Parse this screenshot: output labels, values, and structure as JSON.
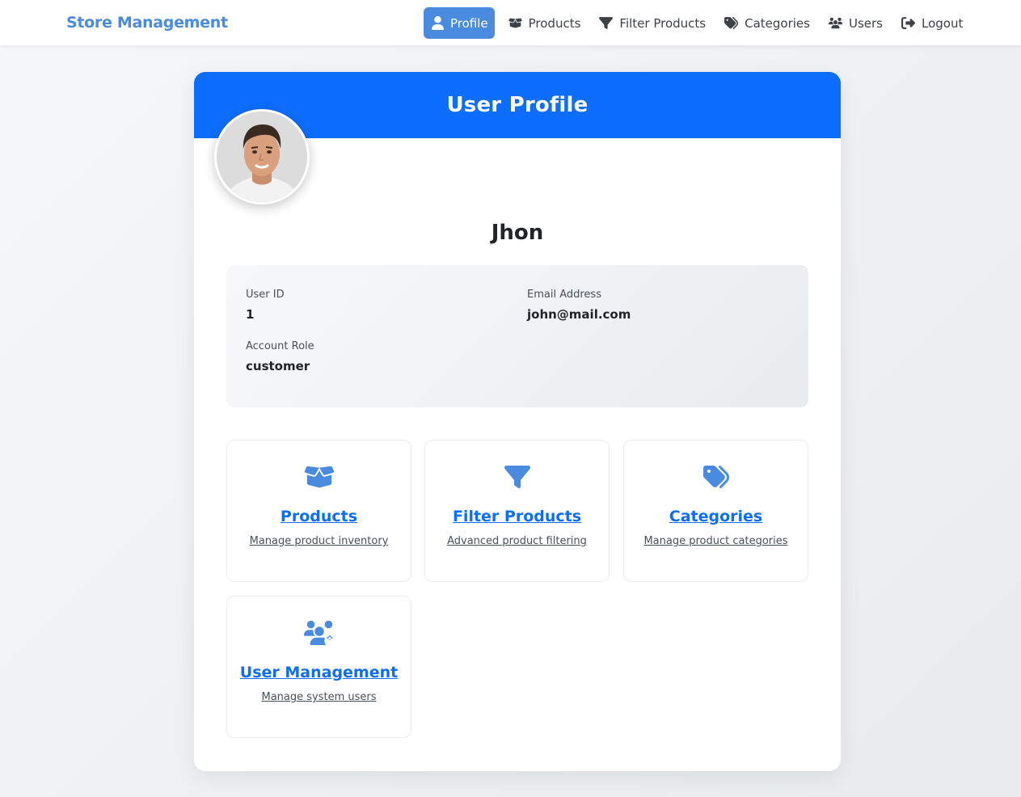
{
  "navbar": {
    "brand": "Store Management",
    "items": [
      {
        "label": "Profile",
        "icon": "user-icon",
        "active": true
      },
      {
        "label": "Products",
        "icon": "box-open-icon"
      },
      {
        "label": "Filter Products",
        "icon": "filter-icon"
      },
      {
        "label": "Categories",
        "icon": "tags-icon"
      },
      {
        "label": "Users",
        "icon": "users-icon"
      },
      {
        "label": "Logout",
        "icon": "logout-icon"
      }
    ]
  },
  "profile": {
    "header_title": "User Profile",
    "name": "Jhon",
    "fields": {
      "user_id_label": "User ID",
      "user_id_value": "1",
      "email_label": "Email Address",
      "email_value": "john@mail.com",
      "role_label": "Account Role",
      "role_value": "customer"
    }
  },
  "tiles": [
    {
      "title": "Products",
      "description": "Manage product inventory",
      "icon": "box-open-icon"
    },
    {
      "title": "Filter Products",
      "description": "Advanced product filtering",
      "icon": "filter-icon"
    },
    {
      "title": "Categories",
      "description": "Manage product categories",
      "icon": "tags-icon"
    },
    {
      "title": "User Management",
      "description": "Manage system users",
      "icon": "users-cog-icon"
    }
  ],
  "colors": {
    "primary": "#0d6efd",
    "accent": "#4a8be0",
    "page_bg": "#f0f2f5"
  }
}
